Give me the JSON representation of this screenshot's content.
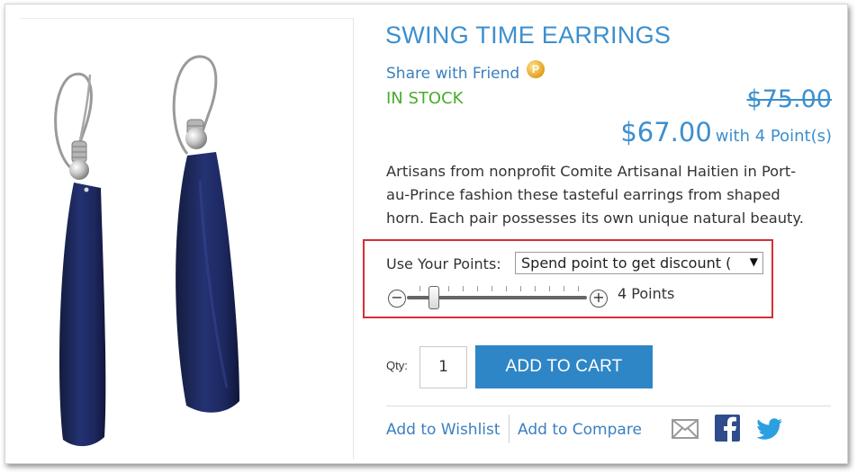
{
  "product": {
    "title": "SWING TIME EARRINGS",
    "share_link": "Share with Friend",
    "points_badge": "P",
    "stock_status": "IN STOCK",
    "old_price": "$75.00",
    "price": "$67.00",
    "price_points_note": "with 4 Point(s)",
    "description": "Artisans from nonprofit Comite Artisanal Haitien in Port-au-Prince fashion these tasteful earrings from shaped horn. Each pair possesses its own unique natural beauty.",
    "image_icon": "earrings-image"
  },
  "points": {
    "label": "Use Your Points:",
    "select_value": "Spend point to get discount (",
    "minus_glyph": "−",
    "plus_glyph": "+",
    "slider_value_text": "4 Points",
    "slider_level": 0.1
  },
  "cart": {
    "qty_label": "Qty:",
    "qty_value": "1",
    "add_to_cart_label": "ADD TO CART"
  },
  "links": {
    "wishlist": "Add to Wishlist",
    "compare": "Add to Compare"
  },
  "share_icons": [
    "email-icon",
    "facebook-icon",
    "twitter-icon"
  ],
  "colors": {
    "accent_blue": "#3c8fce",
    "button_blue": "#2e86c6",
    "in_stock_green": "#4aab2c",
    "highlight_red": "#d62e35",
    "earring_navy": "#1b2654"
  }
}
